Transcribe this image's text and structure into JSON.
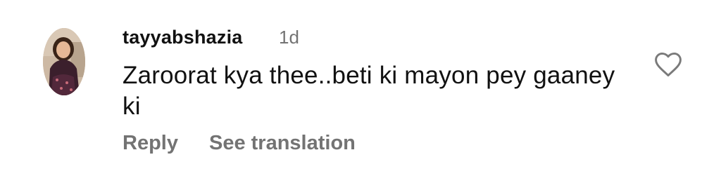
{
  "comment": {
    "username": "tayyabshazia",
    "timestamp": "1d",
    "text": "Zaroorat kya thee..beti ki mayon pey gaaney ki",
    "actions": {
      "reply": "Reply",
      "see_translation": "See translation"
    },
    "like_icon": "heart-outline-icon"
  }
}
